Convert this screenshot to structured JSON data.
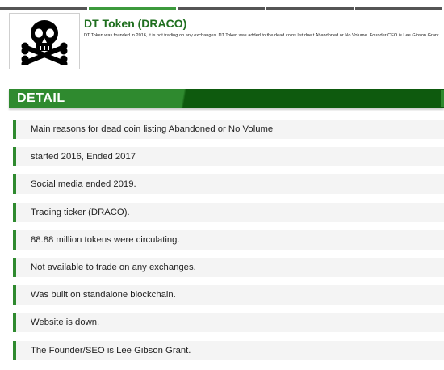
{
  "coin": {
    "title": "DT Token (DRACO)",
    "description": "DT Token was founded in 2016, it is not trading on any exchanges. DT Token was added to the dead coins list due t Abandoned or No Volume. Founder/CEO is Lee Gibson Grant",
    "logo_icon": "skull-crossbones-icon"
  },
  "detail": {
    "heading": "DETAIL",
    "items": [
      "Main reasons for dead coin listing Abandoned or No Volume",
      "started 2016, Ended 2017",
      "Social media ended 2019.",
      "Trading ticker (DRACO).",
      "88.88 million tokens were circulating.",
      "Not available to trade on any exchanges.",
      "Was built on standalone blockchain.",
      "Website is down.",
      "The Founder/SEO is Lee Gibson Grant."
    ]
  },
  "colors": {
    "accent": "#2f8a2f",
    "accent_dark": "#0e5a0e",
    "title": "#1f6f1f"
  }
}
